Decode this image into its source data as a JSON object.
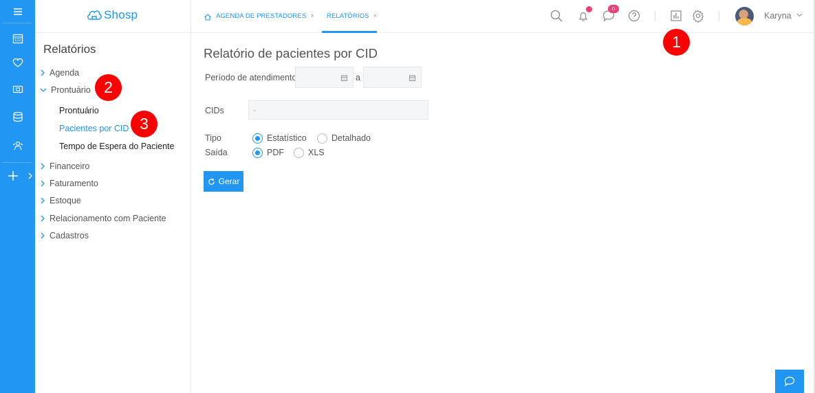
{
  "brand": {
    "name": "Shosp",
    "color": "#2196f3"
  },
  "rail": {
    "icons": [
      "menu-icon",
      "calendar-icon",
      "heart-icon",
      "money-icon",
      "database-icon",
      "users-icon",
      "plus-icon"
    ]
  },
  "sidebar": {
    "title": "Relatórios",
    "items": [
      {
        "label": "Agenda"
      },
      {
        "label": "Prontuário"
      },
      {
        "label": "Financeiro"
      },
      {
        "label": "Faturamento"
      },
      {
        "label": "Estoque"
      },
      {
        "label": "Relacionamento com Paciente"
      },
      {
        "label": "Cadastros"
      }
    ],
    "subitems": [
      {
        "label": "Prontuário"
      },
      {
        "label": "Pacientes por CID"
      },
      {
        "label": "Tempo de Espera do Paciente"
      }
    ]
  },
  "topbar": {
    "tabs": [
      {
        "label": "AGENDA DE PRESTADORES",
        "close": "×"
      },
      {
        "label": "RELATÓRIOS",
        "close": "×"
      }
    ],
    "messages_badge": "0",
    "username": "Karyna"
  },
  "report": {
    "title": "Relatório de pacientes por CID",
    "period_label": "Período de atendimento",
    "period_sep": "a",
    "cids_label": "CIDs",
    "cids_value": "-",
    "tipo_label": "Tipo",
    "tipo_options": [
      "Estatístico",
      "Detalhado"
    ],
    "tipo_selected": "Estatístico",
    "saida_label": "Saída",
    "saida_options": [
      "PDF",
      "XLS"
    ],
    "saida_selected": "PDF",
    "generate_label": "Gerar"
  },
  "markers": [
    "1",
    "2",
    "3"
  ],
  "colors": {
    "accent": "#2196f3",
    "marker": "#ff0000",
    "badge": "#ec407a"
  }
}
